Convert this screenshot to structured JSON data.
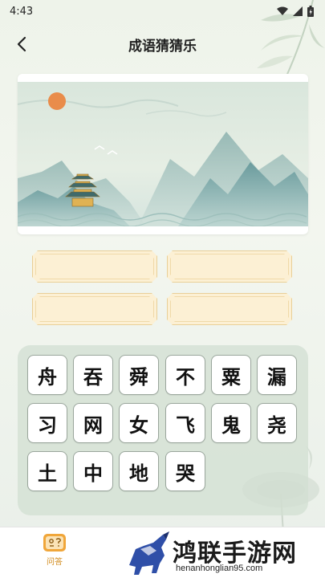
{
  "status_bar": {
    "time": "4:43",
    "icons": [
      "wifi-icon",
      "signal-icon",
      "battery-icon"
    ]
  },
  "header": {
    "title": "成语猜猜乐",
    "back_icon": "chevron-left-icon"
  },
  "answer_slots": [
    "",
    "",
    "",
    ""
  ],
  "characters": [
    "舟",
    "吞",
    "舜",
    "不",
    "粟",
    "漏",
    "习",
    "网",
    "女",
    "飞",
    "鬼",
    "尧",
    "土",
    "中",
    "地",
    "哭"
  ],
  "bottom_nav": {
    "items": [
      {
        "label": "问答",
        "icon": "quiz-book-icon",
        "active": true
      }
    ]
  },
  "watermark": {
    "title": "鸿联手游网",
    "url": "henanhonglian95.com"
  },
  "colors": {
    "accent": "#d18a1a",
    "slot_fill": "#fcf0d4",
    "slot_border": "#e9cf97",
    "grid_panel": "#d1dfd2"
  }
}
